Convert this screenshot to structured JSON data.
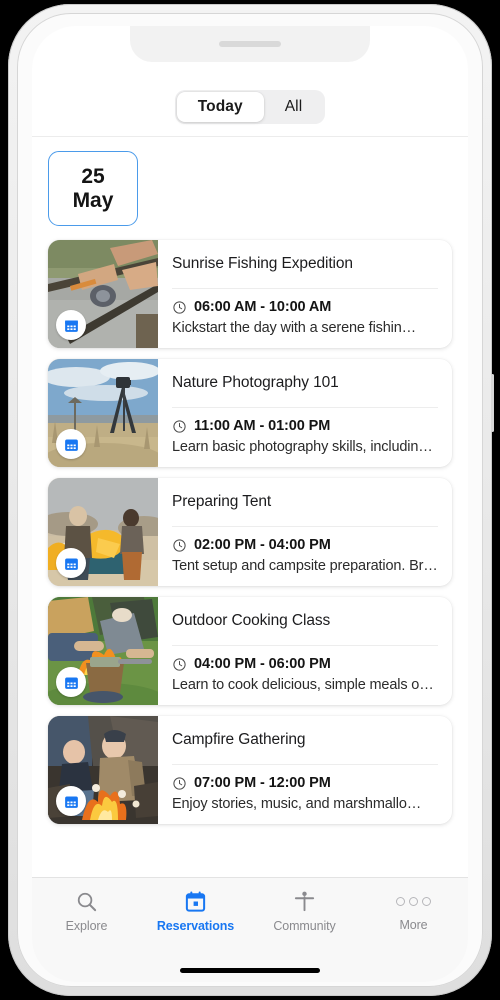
{
  "segmented_control": {
    "options": [
      {
        "label": "Today",
        "active": true
      },
      {
        "label": "All",
        "active": false
      }
    ]
  },
  "date_card": {
    "day": "25",
    "month": "May",
    "border_color": "#4b9bea"
  },
  "events": [
    {
      "title": "Sunrise Fishing Expedition",
      "time": "06:00 AM - 10:00 AM",
      "description": "Kickstart the day with a serene fishin…",
      "badge_icon": "calendar-icon",
      "thumbnail": "fishing-rod-reel-photo"
    },
    {
      "title": "Nature Photography 101",
      "time": "11:00 AM - 01:00 PM",
      "description": "Learn basic photography skills, including…",
      "badge_icon": "calendar-icon",
      "thumbnail": "camera-tripod-hillside-photo"
    },
    {
      "title": "Preparing Tent",
      "time": "02:00 PM - 04:00 PM",
      "description": "Tent setup and campsite preparation. Brin…",
      "badge_icon": "calendar-icon",
      "thumbnail": "yellow-tent-setup-photo"
    },
    {
      "title": "Outdoor Cooking Class",
      "time": "04:00 PM - 06:00 PM",
      "description": "Learn to cook delicious, simple meals ov…",
      "badge_icon": "calendar-icon",
      "thumbnail": "campfire-cooking-pot-photo"
    },
    {
      "title": "Campfire Gathering",
      "time": "07:00 PM - 12:00 PM",
      "description": "Enjoy stories, music, and marshmallo…",
      "badge_icon": "calendar-icon",
      "thumbnail": "campfire-marshmallows-photo"
    }
  ],
  "tabbar": {
    "accent_color": "#1877f2",
    "inactive_color": "#8a8a8e",
    "items": [
      {
        "label": "Explore",
        "icon": "search-icon",
        "active": false
      },
      {
        "label": "Reservations",
        "icon": "calendar-icon",
        "active": true
      },
      {
        "label": "Community",
        "icon": "person-icon",
        "active": false
      },
      {
        "label": "More",
        "icon": "ellipsis-icon",
        "active": false
      }
    ]
  }
}
